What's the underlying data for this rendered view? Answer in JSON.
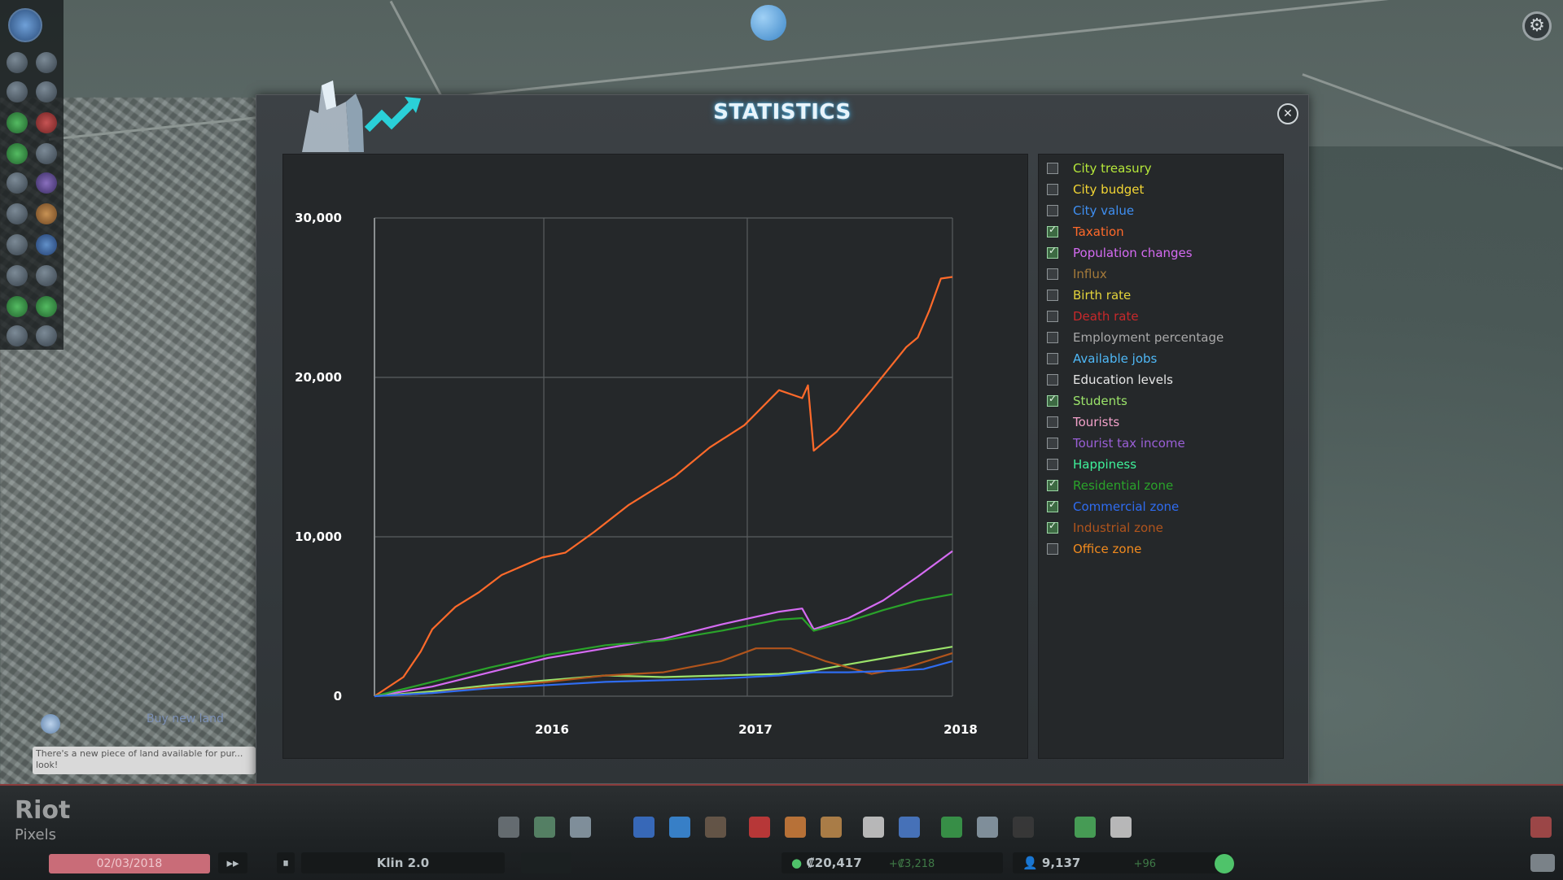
{
  "panel": {
    "title": "STATISTICS",
    "close_icon": "close-icon"
  },
  "legend": [
    {
      "label": "City treasury",
      "color": "#b6e83a",
      "checked": false
    },
    {
      "label": "City budget",
      "color": "#f2d534",
      "checked": false
    },
    {
      "label": "City value",
      "color": "#3f8ff2",
      "checked": false
    },
    {
      "label": "Taxation",
      "color": "#ff6a2a",
      "checked": true
    },
    {
      "label": "Population changes",
      "color": "#d56bf2",
      "checked": true
    },
    {
      "label": "Influx",
      "color": "#a47a3a",
      "checked": false
    },
    {
      "label": "Birth rate",
      "color": "#e3d33b",
      "checked": false
    },
    {
      "label": "Death rate",
      "color": "#c8282b",
      "checked": false
    },
    {
      "label": "Employment percentage",
      "color": "#a9a9a9",
      "checked": false
    },
    {
      "label": "Available jobs",
      "color": "#4fb8f6",
      "checked": false
    },
    {
      "label": "Education levels",
      "color": "#e6e6e6",
      "checked": false
    },
    {
      "label": "Students",
      "color": "#9be36a",
      "checked": true
    },
    {
      "label": "Tourists",
      "color": "#f2a1c9",
      "checked": false
    },
    {
      "label": "Tourist tax income",
      "color": "#9a5fd6",
      "checked": false
    },
    {
      "label": "Happiness",
      "color": "#3ef29a",
      "checked": false
    },
    {
      "label": "Residential zone",
      "color": "#2aa32a",
      "checked": true
    },
    {
      "label": "Commercial zone",
      "color": "#2f6cf0",
      "checked": true
    },
    {
      "label": "Industrial zone",
      "color": "#b0541c",
      "checked": true
    },
    {
      "label": "Office zone",
      "color": "#f08a1e",
      "checked": false
    }
  ],
  "chart_data": {
    "type": "line",
    "ylim": [
      0,
      30000
    ],
    "y_ticks": [
      "0",
      "10,000",
      "20,000",
      "30,000"
    ],
    "x_ticks": [
      "2016",
      "2017",
      "2018"
    ],
    "x_domain": [
      0,
      1
    ],
    "x_tick_positions": [
      0.293,
      0.645,
      1.0
    ],
    "series": [
      {
        "name": "Taxation",
        "color": "#ff6a2a",
        "points": [
          [
            0,
            0
          ],
          [
            0.05,
            1200
          ],
          [
            0.08,
            2800
          ],
          [
            0.1,
            4200
          ],
          [
            0.14,
            5600
          ],
          [
            0.18,
            6500
          ],
          [
            0.22,
            7600
          ],
          [
            0.29,
            8700
          ],
          [
            0.33,
            9000
          ],
          [
            0.38,
            10300
          ],
          [
            0.44,
            12000
          ],
          [
            0.52,
            13800
          ],
          [
            0.58,
            15600
          ],
          [
            0.64,
            17000
          ],
          [
            0.7,
            19200
          ],
          [
            0.74,
            18700
          ],
          [
            0.75,
            19500
          ],
          [
            0.76,
            15400
          ],
          [
            0.8,
            16600
          ],
          [
            0.86,
            19200
          ],
          [
            0.92,
            21900
          ],
          [
            0.94,
            22500
          ],
          [
            0.96,
            24200
          ],
          [
            0.98,
            26200
          ],
          [
            1.0,
            26300
          ]
        ]
      },
      {
        "name": "Population changes",
        "color": "#d56bf2",
        "points": [
          [
            0,
            0
          ],
          [
            0.1,
            600
          ],
          [
            0.2,
            1500
          ],
          [
            0.3,
            2400
          ],
          [
            0.4,
            3000
          ],
          [
            0.5,
            3600
          ],
          [
            0.6,
            4500
          ],
          [
            0.7,
            5300
          ],
          [
            0.74,
            5500
          ],
          [
            0.76,
            4200
          ],
          [
            0.82,
            4900
          ],
          [
            0.88,
            6000
          ],
          [
            0.94,
            7500
          ],
          [
            1.0,
            9100
          ]
        ]
      },
      {
        "name": "Residential zone",
        "color": "#2aa32a",
        "points": [
          [
            0,
            0
          ],
          [
            0.1,
            900
          ],
          [
            0.2,
            1800
          ],
          [
            0.3,
            2600
          ],
          [
            0.4,
            3200
          ],
          [
            0.5,
            3500
          ],
          [
            0.6,
            4100
          ],
          [
            0.7,
            4800
          ],
          [
            0.74,
            4900
          ],
          [
            0.76,
            4100
          ],
          [
            0.82,
            4700
          ],
          [
            0.88,
            5400
          ],
          [
            0.94,
            6000
          ],
          [
            1.0,
            6400
          ]
        ]
      },
      {
        "name": "Students",
        "color": "#9be36a",
        "points": [
          [
            0,
            0
          ],
          [
            0.1,
            300
          ],
          [
            0.2,
            700
          ],
          [
            0.3,
            1000
          ],
          [
            0.4,
            1300
          ],
          [
            0.5,
            1200
          ],
          [
            0.6,
            1300
          ],
          [
            0.7,
            1400
          ],
          [
            0.76,
            1600
          ],
          [
            0.82,
            2000
          ],
          [
            0.9,
            2500
          ],
          [
            1.0,
            3100
          ]
        ]
      },
      {
        "name": "Industrial zone",
        "color": "#b0541c",
        "points": [
          [
            0,
            0
          ],
          [
            0.1,
            200
          ],
          [
            0.2,
            600
          ],
          [
            0.3,
            900
          ],
          [
            0.4,
            1300
          ],
          [
            0.5,
            1500
          ],
          [
            0.6,
            2200
          ],
          [
            0.66,
            3000
          ],
          [
            0.72,
            3000
          ],
          [
            0.78,
            2200
          ],
          [
            0.86,
            1400
          ],
          [
            0.92,
            1800
          ],
          [
            1.0,
            2700
          ]
        ]
      },
      {
        "name": "Commercial zone",
        "color": "#2f6cf0",
        "points": [
          [
            0,
            0
          ],
          [
            0.1,
            200
          ],
          [
            0.2,
            500
          ],
          [
            0.3,
            700
          ],
          [
            0.4,
            900
          ],
          [
            0.5,
            1000
          ],
          [
            0.6,
            1100
          ],
          [
            0.7,
            1300
          ],
          [
            0.76,
            1500
          ],
          [
            0.82,
            1500
          ],
          [
            0.9,
            1600
          ],
          [
            0.95,
            1700
          ],
          [
            1.0,
            2200
          ]
        ]
      }
    ]
  },
  "notification": {
    "title": "Buy new land",
    "message": "There's a new piece of land available for pur... look!"
  },
  "bottom": {
    "date": "02/03/2018",
    "city_name": "Klin 2.0",
    "money": "₡20,417",
    "money_delta": "+₡3,218",
    "population": "9,137",
    "population_delta": "+96"
  },
  "watermark": {
    "line1": "Riot",
    "line2": "Pixels"
  }
}
